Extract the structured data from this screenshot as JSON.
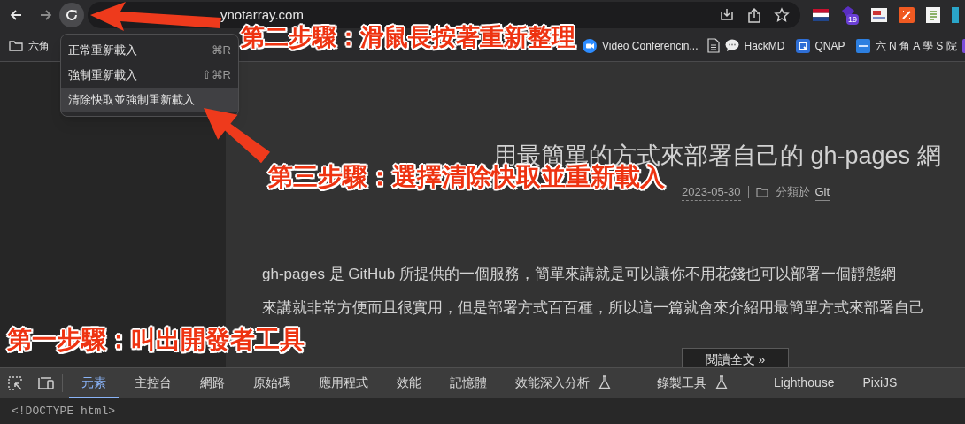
{
  "toolbar": {
    "url": "ynotarray.com"
  },
  "extensions": [
    {
      "kind": "flag"
    },
    {
      "kind": "gem",
      "badge": "19"
    },
    {
      "kind": "card"
    },
    {
      "kind": "percent"
    },
    {
      "kind": "sheet"
    },
    {
      "kind": "cyan"
    }
  ],
  "bookmarks": [
    {
      "kind": "folder",
      "label": "六角"
    },
    {
      "kind": "video",
      "label": "Video Conferencin..."
    },
    {
      "kind": "doc"
    },
    {
      "kind": "chat",
      "label": "HackMD"
    },
    {
      "kind": "qnap",
      "label": "QNAP"
    },
    {
      "kind": "dsm",
      "label": "六 N 角 A 學 S 院"
    },
    {
      "kind": "list"
    }
  ],
  "reload_menu": {
    "items": [
      {
        "label": "正常重新載入",
        "shortcut": "⌘R",
        "selected": false
      },
      {
        "label": "強制重新載入",
        "shortcut": "⇧⌘R",
        "selected": false
      },
      {
        "label": "清除快取並強制重新載入",
        "selected": true
      }
    ]
  },
  "article": {
    "title": "用最簡單的方式來部署自己的 gh-pages 網",
    "date": "2023-05-30",
    "category_label": "分類於",
    "category": "Git",
    "paragraphs": [
      "gh-pages 是 GitHub 所提供的一個服務，簡單來講就是可以讓你不用花錢也可以部署一個靜態網",
      "來講就非常方便而且很實用，但是部署方式百百種，所以這一篇就會來介紹用最簡單方式來部署自己"
    ],
    "read_more": "閱讀全文 »"
  },
  "devtools": {
    "tabs": [
      {
        "label": "元素",
        "selected": true
      },
      {
        "label": "主控台",
        "selected": false
      },
      {
        "label": "網路",
        "selected": false
      },
      {
        "label": "原始碼",
        "selected": false
      },
      {
        "label": "應用程式",
        "selected": false
      },
      {
        "label": "效能",
        "selected": false
      },
      {
        "label": "記憶體",
        "selected": false
      },
      {
        "label": "效能深入分析",
        "selected": false,
        "experimental": true
      },
      {
        "label": "錄製工具",
        "selected": false,
        "experimental": true
      },
      {
        "label": "Lighthouse",
        "selected": false
      },
      {
        "label": "PixiJS",
        "selected": false
      }
    ],
    "source": "<!DOCTYPE html>"
  },
  "annotations": [
    "第二步驟：滑鼠長按著重新整理",
    "第三步驟：選擇清除快取並重新載入",
    "第一步驟：叫出開發者工具"
  ]
}
